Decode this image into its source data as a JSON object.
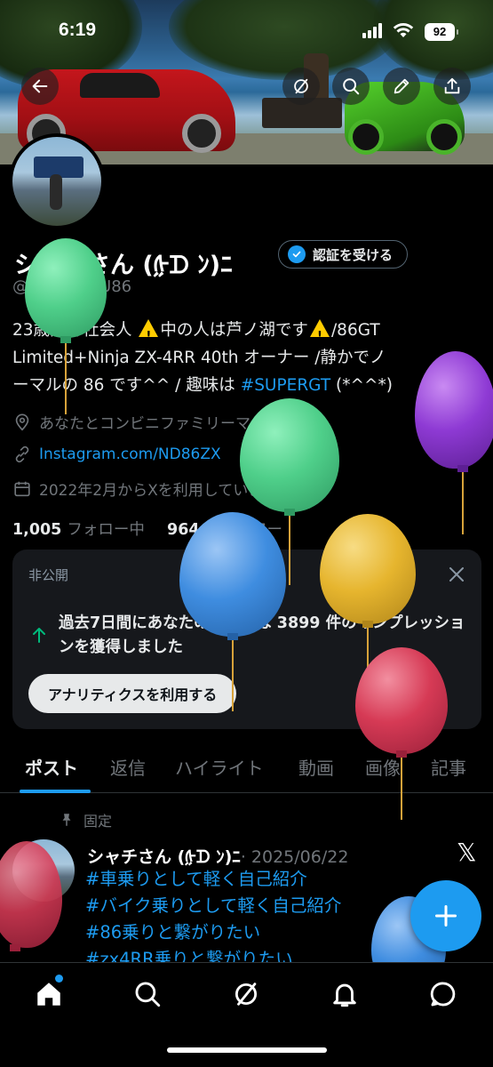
{
  "status_bar": {
    "time": "6:19",
    "battery": "92"
  },
  "profile": {
    "name": "シャチさん (ᢔᗪ ﾝ)ﾆ",
    "handle": "@PEDATETU86",
    "verify_button": "認証を受ける",
    "bio_lines": [
      {
        "a": "23歳限界社会人 ",
        "b": "中の人は芦ノ湖です",
        "c": "/86GT"
      },
      {
        "a": "Limited+Ninja ZX-4RR 40th オーナー /静かでノ"
      },
      {
        "a": "ーマルの 86 です^^ / 趣味は ",
        "tag": "#SUPERGT",
        "c": " (*^^*)"
      }
    ],
    "location": "あなたとコンビニファミリーマート",
    "link": "Instagram.com/ND86ZX",
    "joined": "2022年2月からXを利用しています",
    "following_count": "1,005",
    "following_label": "フォロー中",
    "followers_count": "964",
    "followers_label": "フォロワー"
  },
  "private_card": {
    "title": "非公開",
    "message": "過去7日間にあなたのポストは 3899 件のインプレッションを獲得しました",
    "cta": "アナリティクスを利用する"
  },
  "tabs": [
    "ポスト",
    "返信",
    "ハイライト",
    "動画",
    "画像",
    "記事"
  ],
  "pinned_post": {
    "pinned_label": "固定",
    "author": "シャチさん (ᢔᗪ ﾝ)ﾆ",
    "date": "· 2025/06/22",
    "lines": [
      "#車乗りとして軽く自己紹介",
      " #バイク乗りとして軽く自己紹介",
      " #86乗りと繋がりたい",
      " #zx4RR乗りと繋がりたい"
    ],
    "x_logo": "𝕏"
  },
  "colors": {
    "accent": "#1d9bf0",
    "balloon_green": "#4fcf8a",
    "balloon_purple": "#8e3ad4",
    "balloon_blue": "#3f8de0",
    "balloon_yellow": "#e6b52e",
    "balloon_red": "#d63a55"
  },
  "icons": [
    "back-arrow-icon",
    "grok-icon",
    "search-icon",
    "edit-icon",
    "share-icon",
    "location-icon",
    "link-icon",
    "calendar-icon",
    "chevron-right-icon",
    "close-icon",
    "up-arrow-icon",
    "pin-icon",
    "plus-icon",
    "home-icon",
    "explore-icon",
    "grok-nav-icon",
    "notifications-icon",
    "messages-icon"
  ]
}
